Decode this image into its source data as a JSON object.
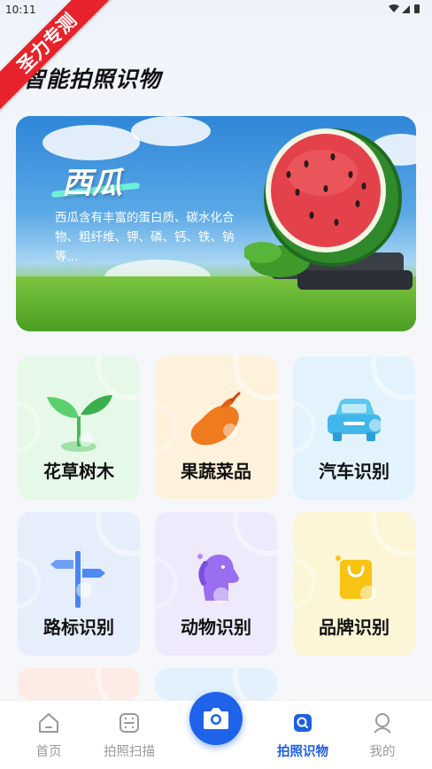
{
  "status_bar": {
    "time": "10:11",
    "icons": "▼◢▮"
  },
  "ribbon": {
    "text": "圣力专测"
  },
  "header": {
    "title": "智能拍照识物"
  },
  "banner": {
    "title": "西瓜",
    "description": "西瓜含有丰富的蛋白质、碳水化合物、粗纤维、钾、磷、钙、铁、钠等..."
  },
  "categories": [
    {
      "label": "花草树木",
      "icon": "sprout-icon",
      "bg": "#e6f8e8"
    },
    {
      "label": "果蔬菜品",
      "icon": "eggplant-icon",
      "bg": "#fff2dc"
    },
    {
      "label": "汽车识别",
      "icon": "car-icon",
      "bg": "#e3f3fd"
    },
    {
      "label": "路标识别",
      "icon": "signpost-icon",
      "bg": "#e6eefc"
    },
    {
      "label": "动物识别",
      "icon": "dog-icon",
      "bg": "#efe9fc"
    },
    {
      "label": "品牌识别",
      "icon": "shopping-bag-icon",
      "bg": "#fdf6d6"
    }
  ],
  "bottom_nav": {
    "items": [
      {
        "label": "首页",
        "icon": "home-icon"
      },
      {
        "label": "拍照扫描",
        "icon": "scan-icon"
      },
      {
        "label": "拍照识物",
        "icon": "search-photo-icon"
      },
      {
        "label": "我的",
        "icon": "profile-icon"
      }
    ],
    "active_index": 2,
    "camera_icon": "camera-icon"
  }
}
